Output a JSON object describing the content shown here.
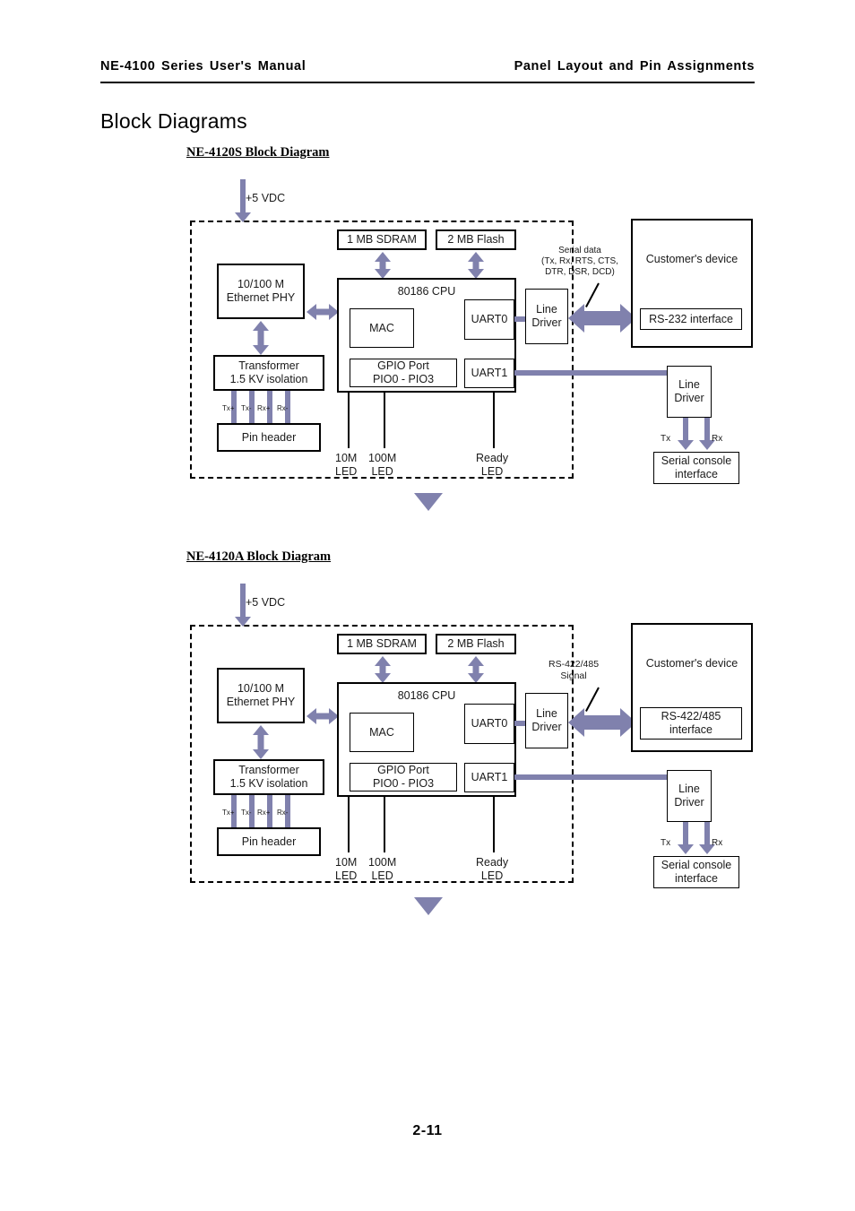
{
  "header": {
    "left": "NE-4100 Series User's Manual",
    "right": "Panel Layout and Pin Assignments"
  },
  "section_title": "Block Diagrams",
  "page_number": "2-11",
  "diagrams": [
    {
      "heading": "NE-4120S Block Diagram",
      "power_label": "+5 VDC",
      "sdram": "1 MB SDRAM",
      "flash": "2 MB Flash",
      "phy": "10/100 M\nEthernet PHY",
      "transformer": "Transformer\n1.5 KV isolation",
      "pin_header": "Pin header",
      "pin_signals": [
        "Tx+",
        "Tx-",
        "Rx+",
        "Rx-"
      ],
      "cpu": "80186 CPU",
      "mac": "MAC",
      "gpio": "GPIO Port\nPIO0 - PIO3",
      "uart0": "UART0",
      "uart1": "UART1",
      "line_driver_0": "Line\nDriver",
      "line_driver_1": "Line\nDriver",
      "led_10m": "10M\nLED",
      "led_100m": "100M\nLED",
      "led_ready": "Ready\nLED",
      "signal_callout": "Serial data\n(Tx, Rx, RTS, CTS,\nDTR, DSR, DCD)",
      "customer_device": "Customer's device",
      "interface": "RS-232 interface",
      "console_tx": "Tx",
      "console_rx": "Rx",
      "console": "Serial console\ninterface"
    },
    {
      "heading": "NE-4120A Block Diagram",
      "power_label": "+5 VDC",
      "sdram": "1 MB SDRAM",
      "flash": "2 MB Flash",
      "phy": "10/100 M\nEthernet PHY",
      "transformer": "Transformer\n1.5 KV isolation",
      "pin_header": "Pin header",
      "pin_signals": [
        "Tx+",
        "Tx-",
        "Rx+",
        "Rx-"
      ],
      "cpu": "80186 CPU",
      "mac": "MAC",
      "gpio": "GPIO Port\nPIO0 - PIO3",
      "uart0": "UART0",
      "uart1": "UART1",
      "line_driver_0": "Line\nDriver",
      "line_driver_1": "Line\nDriver",
      "led_10m": "10M\nLED",
      "led_100m": "100M\nLED",
      "led_ready": "Ready\nLED",
      "signal_callout": "RS-422/485\nSignal",
      "customer_device": "Customer's device",
      "interface": "RS-422/485\ninterface",
      "console_tx": "Tx",
      "console_rx": "Rx",
      "console": "Serial console\ninterface"
    }
  ],
  "colors": {
    "accent": "#8081ad",
    "ink": "#000000"
  }
}
